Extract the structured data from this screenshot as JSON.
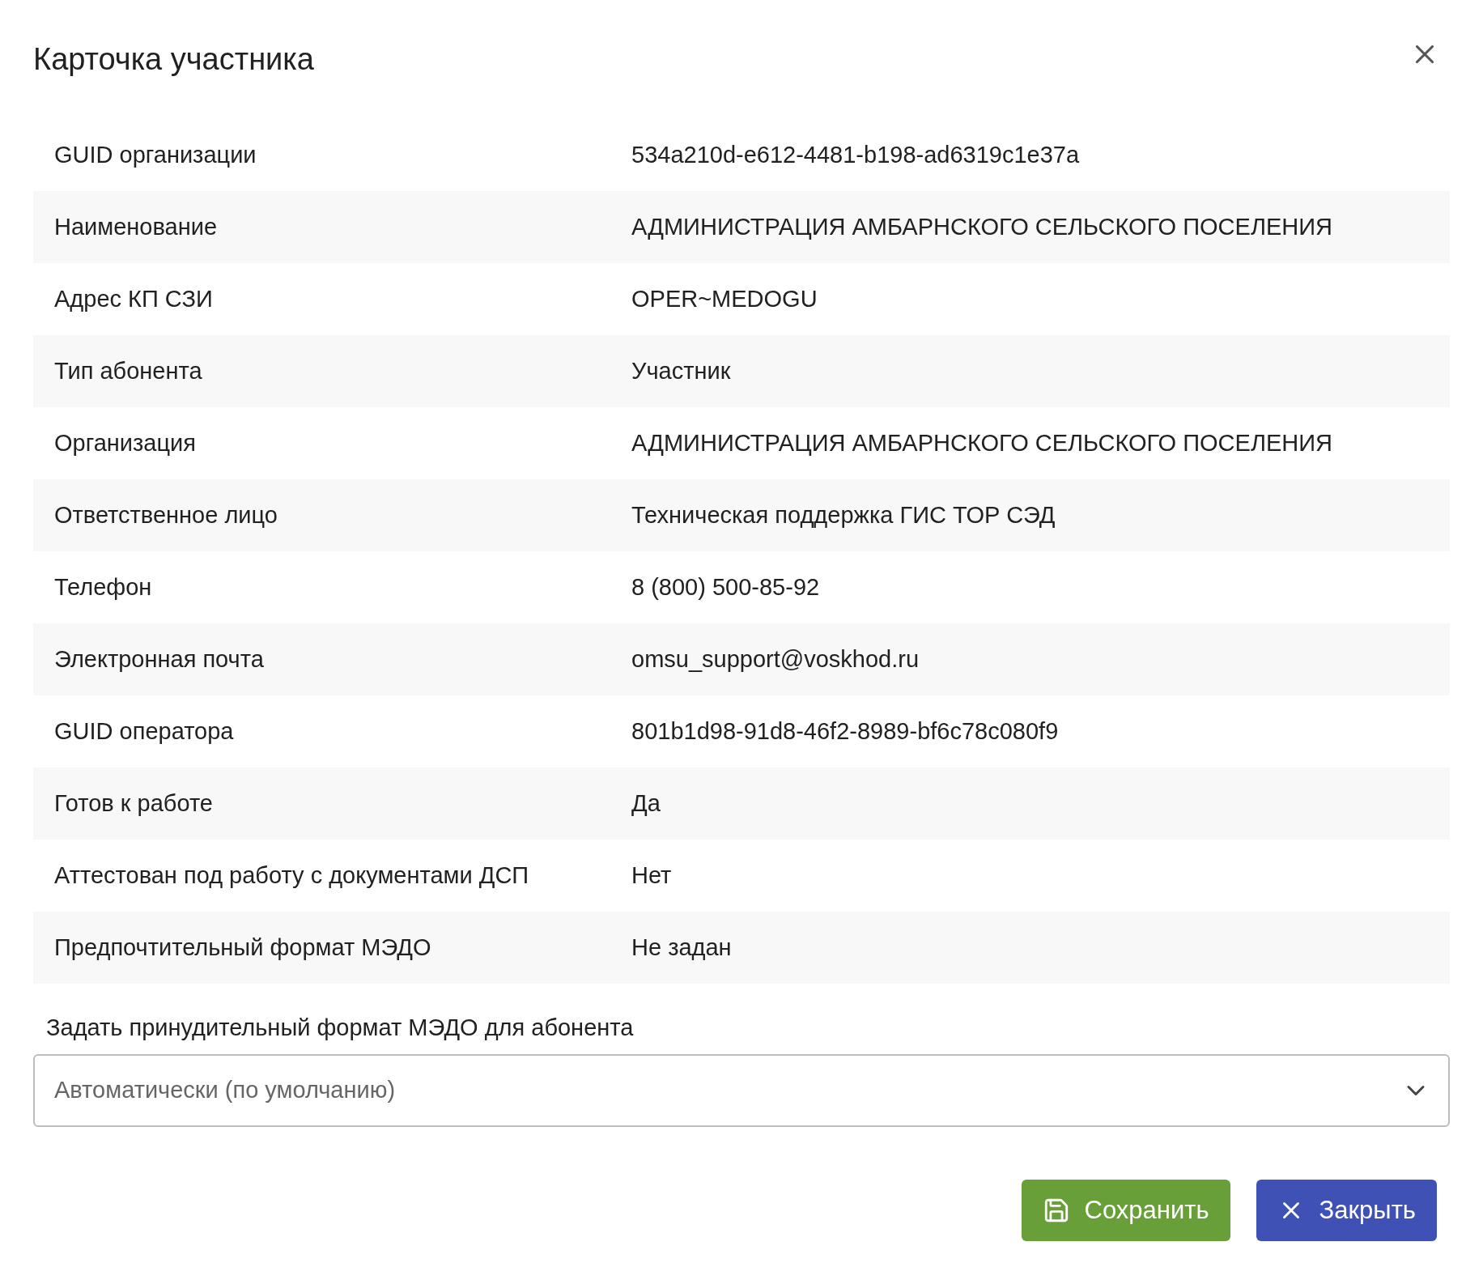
{
  "dialog": {
    "title": "Карточка участника"
  },
  "fields": [
    {
      "label": "GUID организации",
      "value": "534a210d-e612-4481-b198-ad6319c1e37a"
    },
    {
      "label": "Наименование",
      "value": "АДМИНИСТРАЦИЯ АМБАРНСКОГО СЕЛЬСКОГО ПОСЕЛЕНИЯ"
    },
    {
      "label": "Адрес КП СЗИ",
      "value": "OPER~MEDOGU"
    },
    {
      "label": "Тип абонента",
      "value": "Участник"
    },
    {
      "label": "Организация",
      "value": "АДМИНИСТРАЦИЯ АМБАРНСКОГО СЕЛЬСКОГО ПОСЕЛЕНИЯ"
    },
    {
      "label": "Ответственное лицо",
      "value": "Техническая поддержка ГИС ТОР СЭД"
    },
    {
      "label": "Телефон",
      "value": "8 (800) 500-85-92"
    },
    {
      "label": "Электронная почта",
      "value": "omsu_support@voskhod.ru"
    },
    {
      "label": "GUID оператора",
      "value": "801b1d98-91d8-46f2-8989-bf6c78c080f9"
    },
    {
      "label": "Готов к работе",
      "value": "Да"
    },
    {
      "label": "Аттестован под работу с документами ДСП",
      "value": "Нет"
    },
    {
      "label": "Предпочтительный формат МЭДО",
      "value": "Не задан"
    }
  ],
  "format_select": {
    "label": "Задать принудительный формат МЭДО для абонента",
    "value": "Автоматически (по умолчанию)"
  },
  "buttons": [
    {
      "kind": "save",
      "label": "Сохранить"
    },
    {
      "kind": "close",
      "label": "Закрыть"
    }
  ]
}
